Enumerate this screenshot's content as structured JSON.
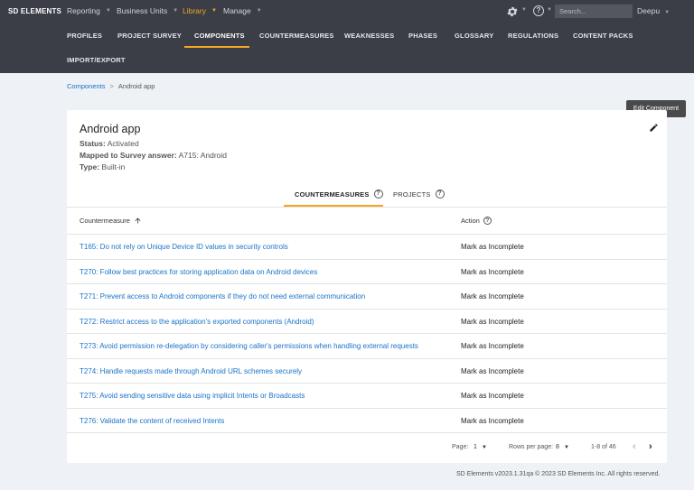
{
  "nav": {
    "logo": "SD ELEMENTS",
    "menus": [
      {
        "label": "Reporting"
      },
      {
        "label": "Business Units"
      },
      {
        "label": "Library"
      },
      {
        "label": "Manage"
      }
    ],
    "search_placeholder": "Search...",
    "help": "?",
    "user": "Deepu",
    "accent_color": "#f5a623"
  },
  "subnav": {
    "tabs": [
      {
        "label": "PROFILES"
      },
      {
        "label": "PROJECT SURVEY"
      },
      {
        "label": "COMPONENTS"
      },
      {
        "label": "COUNTERMEASURES"
      },
      {
        "label": "WEAKNESSES"
      },
      {
        "label": "PHASES"
      },
      {
        "label": "GLOSSARY"
      },
      {
        "label": "REGULATIONS"
      },
      {
        "label": "CONTENT PACKS"
      },
      {
        "label": "IMPORT/EXPORT"
      }
    ],
    "active": "COMPONENTS"
  },
  "breadcrumb": {
    "root": "Components",
    "separator": ">",
    "current": "Android app"
  },
  "tooltip": "Edit Component",
  "component": {
    "title": "Android app",
    "status_label": "Status:",
    "status_value": "Activated",
    "survey_label": "Mapped to Survey answer:",
    "survey_value": "A715: Android",
    "type_label": "Type:",
    "type_value": "Built-in"
  },
  "content_tabs": [
    {
      "label": "COUNTERMEASURES"
    },
    {
      "label": "PROJECTS"
    }
  ],
  "table": {
    "col_countermeasure": "Countermeasure",
    "col_action": "Action",
    "rows": [
      {
        "countermeasure": "T165: Do not rely on Unique Device ID values in security controls",
        "action": "Mark as Incomplete"
      },
      {
        "countermeasure": "T270: Follow best practices for storing application data on Android devices",
        "action": "Mark as Incomplete"
      },
      {
        "countermeasure": "T271: Prevent access to Android components if they do not need external communication",
        "action": "Mark as Incomplete"
      },
      {
        "countermeasure": "T272: Restrict access to the application's exported components (Android)",
        "action": "Mark as Incomplete"
      },
      {
        "countermeasure": "T273: Avoid permission re-delegation by considering caller's permissions when handling external requests",
        "action": "Mark as Incomplete"
      },
      {
        "countermeasure": "T274: Handle requests made through Android URL schemes securely",
        "action": "Mark as Incomplete"
      },
      {
        "countermeasure": "T275: Avoid sending sensitive data using implicit Intents or Broadcasts",
        "action": "Mark as Incomplete"
      },
      {
        "countermeasure": "T276: Validate the content of received Intents",
        "action": "Mark as Incomplete"
      }
    ]
  },
  "pagination": {
    "page_label": "Page:",
    "page_value": "1",
    "rows_label": "Rows per page:",
    "rows_value": "8",
    "range": "1-8 of 46"
  },
  "footer": "SD Elements v2023.1.31qa © 2023 SD Elements Inc. All rights reserved."
}
